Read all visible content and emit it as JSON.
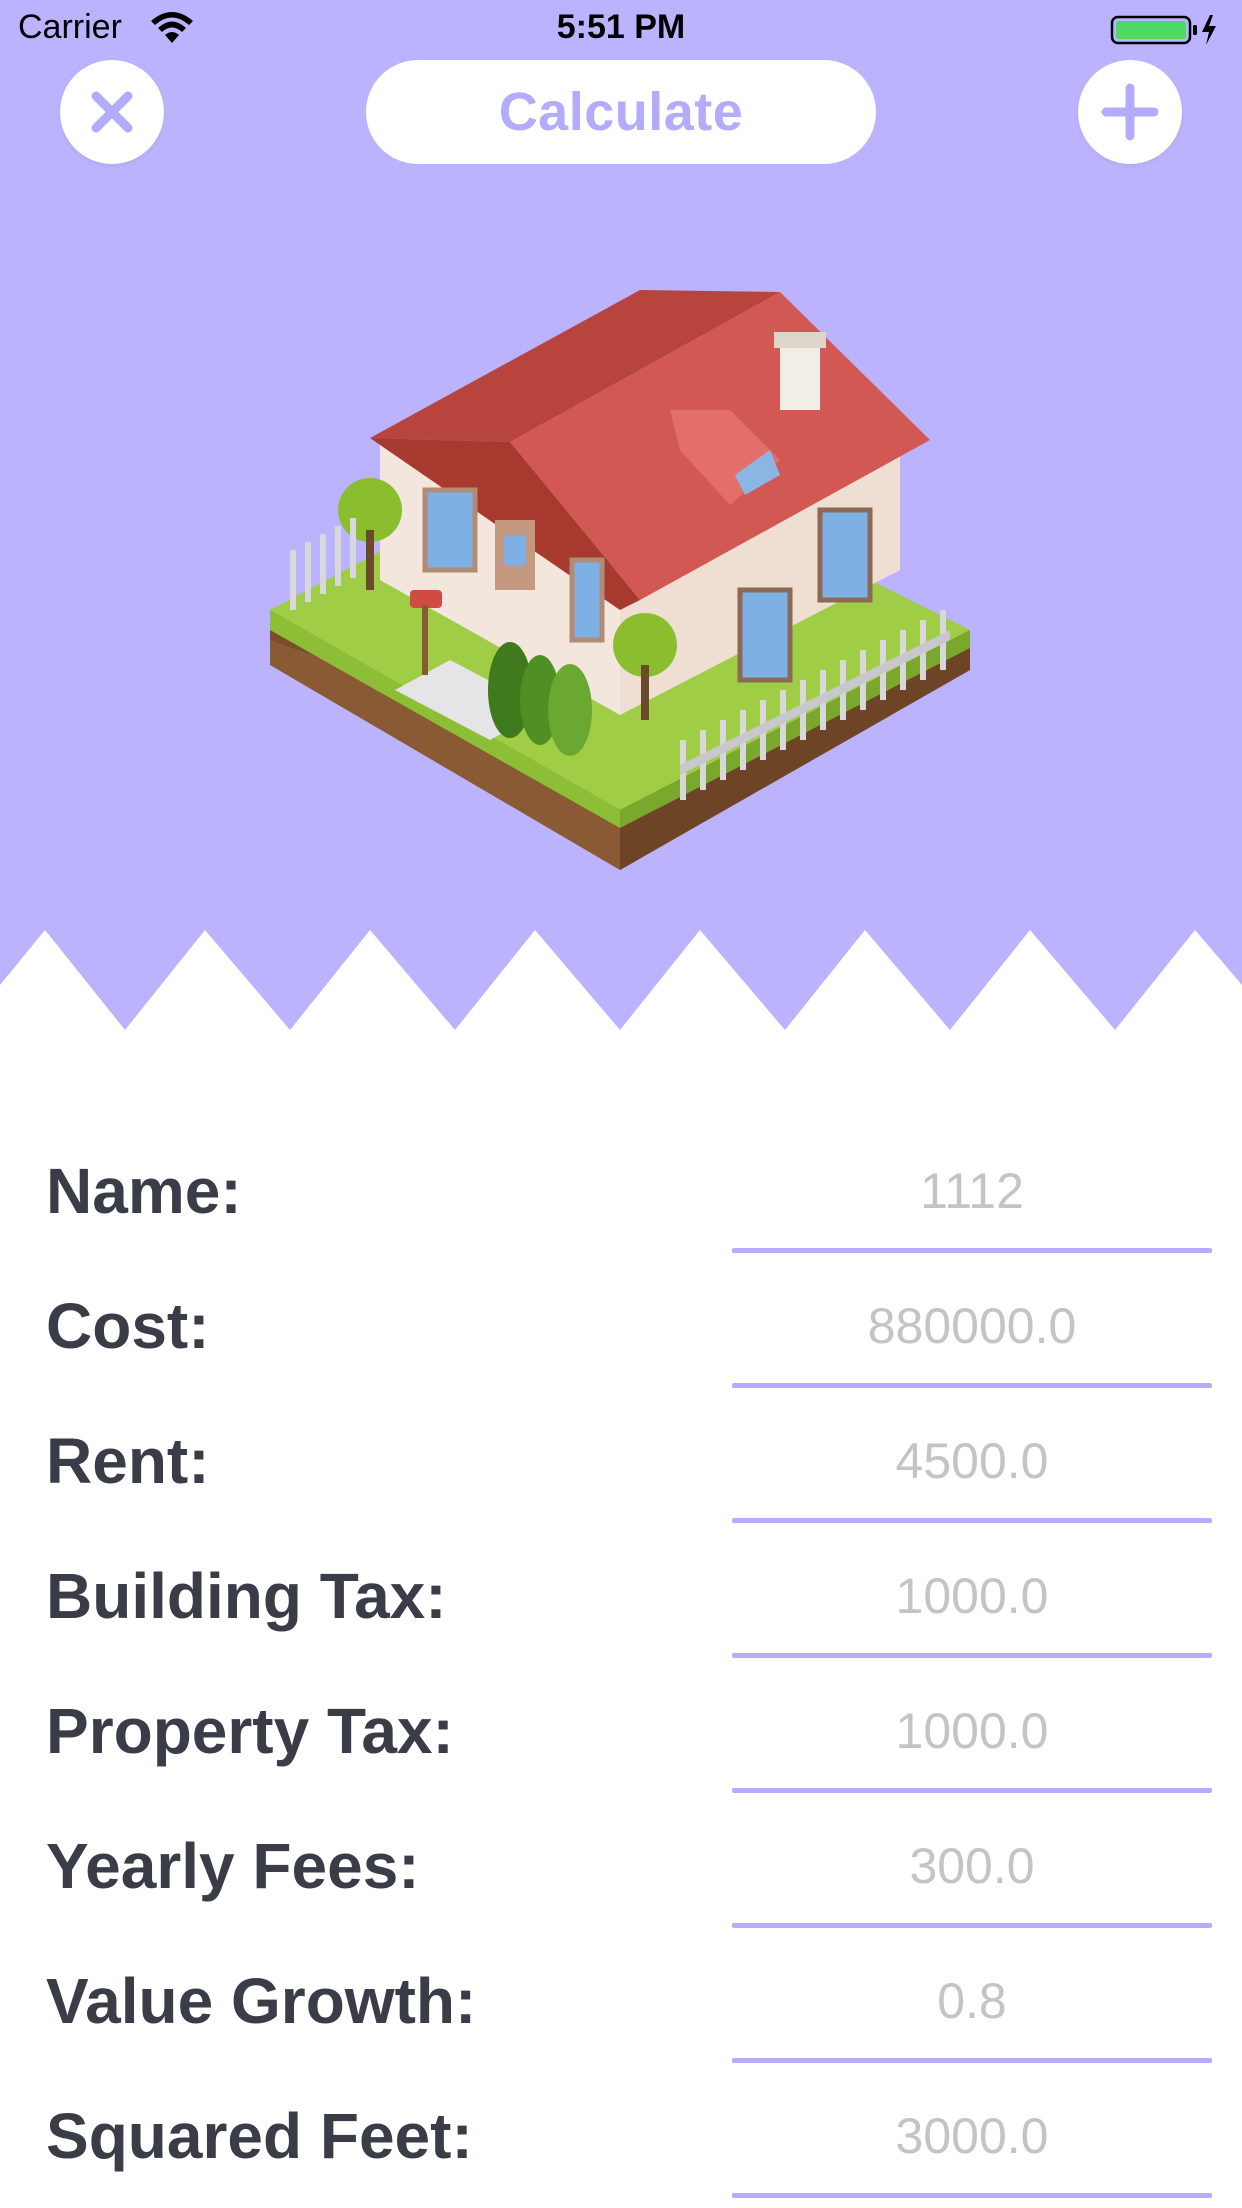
{
  "status_bar": {
    "carrier": "Carrier",
    "time": "5:51 PM",
    "wifi_icon": "wifi-icon",
    "battery_icon": "battery-charging-icon"
  },
  "nav": {
    "close_icon": "close-icon",
    "calculate_label": "Calculate",
    "add_icon": "plus-icon"
  },
  "hero": {
    "illustration": "house-illustration",
    "background_color": "#bbb3fd"
  },
  "form": {
    "fields": [
      {
        "label": "Name:",
        "placeholder": "1112"
      },
      {
        "label": "Cost:",
        "placeholder": "880000.0"
      },
      {
        "label": "Rent:",
        "placeholder": "4500.0"
      },
      {
        "label": "Building Tax:",
        "placeholder": "1000.0"
      },
      {
        "label": "Property Tax:",
        "placeholder": "1000.0"
      },
      {
        "label": "Yearly Fees:",
        "placeholder": "300.0"
      },
      {
        "label": "Value Growth:",
        "placeholder": "0.8"
      },
      {
        "label": "Squared Feet:",
        "placeholder": "3000.0"
      }
    ]
  },
  "colors": {
    "accent": "#bbb3fd",
    "accent_text": "#b3abfb",
    "underline": "#b5acfb",
    "label_text": "#3a3d47",
    "placeholder_text": "#c4c4c8"
  }
}
